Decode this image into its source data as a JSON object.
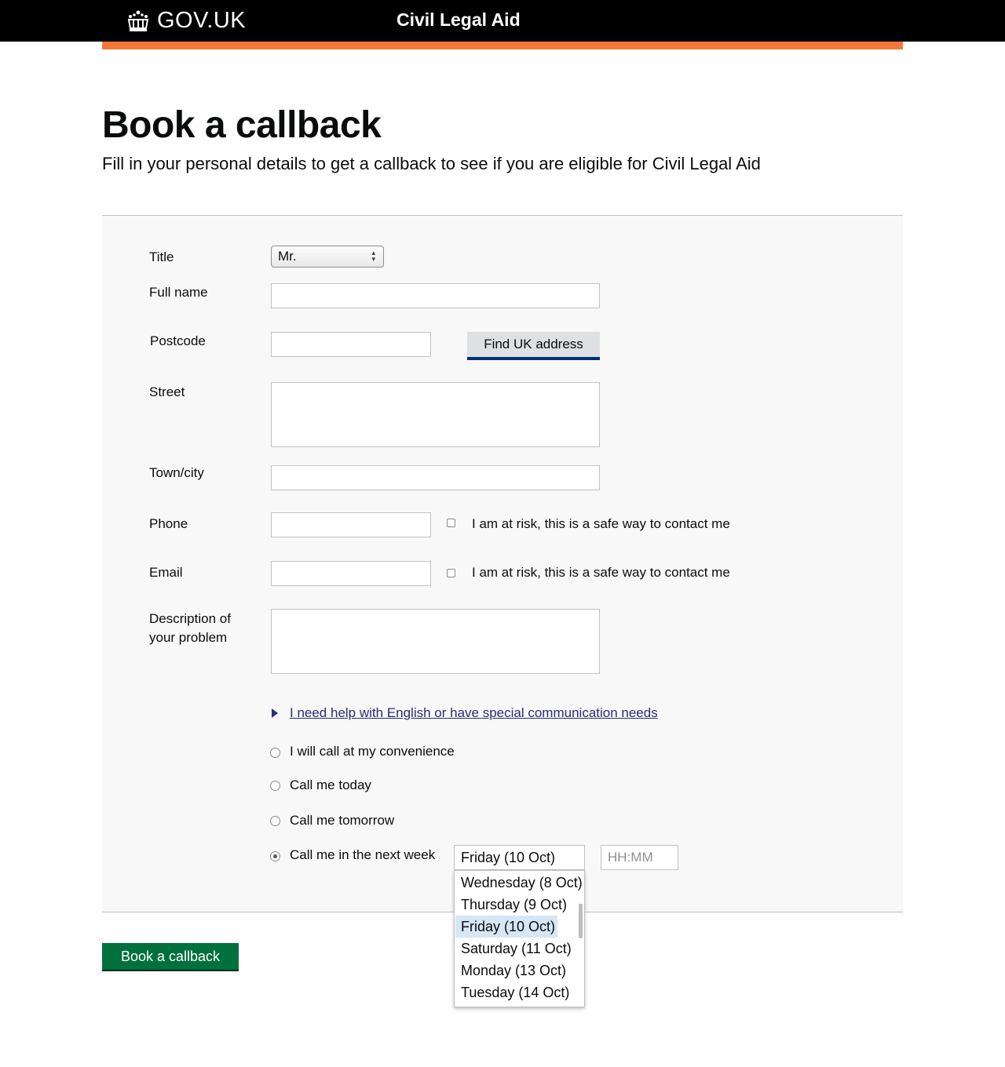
{
  "header": {
    "logo_text": "GOV.UK",
    "service_name": "Civil Legal Aid",
    "accent_color": "#f47738"
  },
  "page": {
    "title": "Book a callback",
    "lede": "Fill in your personal details to get a callback to see if you are eligible for Civil Legal Aid"
  },
  "form": {
    "title_label": "Title",
    "title_value": "Mr.",
    "full_name_label": "Full name",
    "full_name_value": "",
    "postcode_label": "Postcode",
    "postcode_value": "",
    "find_address_label": "Find UK address",
    "street_label": "Street",
    "street_value": "",
    "town_label": "Town/city",
    "town_value": "",
    "phone_label": "Phone",
    "phone_value": "",
    "phone_safe_label": "I am at risk, this is a safe way to contact me",
    "phone_safe_checked": false,
    "email_label": "Email",
    "email_value": "",
    "email_safe_label": "I am at risk, this is a safe way to contact me",
    "email_safe_checked": false,
    "description_label_line1": "Description of",
    "description_label_line2": "your problem",
    "description_value": "",
    "help_link": "I need help with English or have special communication needs",
    "callback_options": [
      {
        "label": "I will call at my convenience",
        "checked": false
      },
      {
        "label": "Call me today",
        "checked": false
      },
      {
        "label": "Call me tomorrow",
        "checked": false
      },
      {
        "label": "Call me in the next week",
        "checked": true
      }
    ],
    "day_select_value": "Friday (10 Oct)",
    "time_placeholder": "HH:MM",
    "day_options": [
      "Wednesday (8 Oct)",
      "Thursday (9 Oct)",
      "Friday (10 Oct)",
      "Saturday (11 Oct)",
      "Monday (13 Oct)",
      "Tuesday (14 Oct)"
    ],
    "day_options_selected_index": 2,
    "submit_label": "Book a callback",
    "submit_color": "#00703c"
  }
}
